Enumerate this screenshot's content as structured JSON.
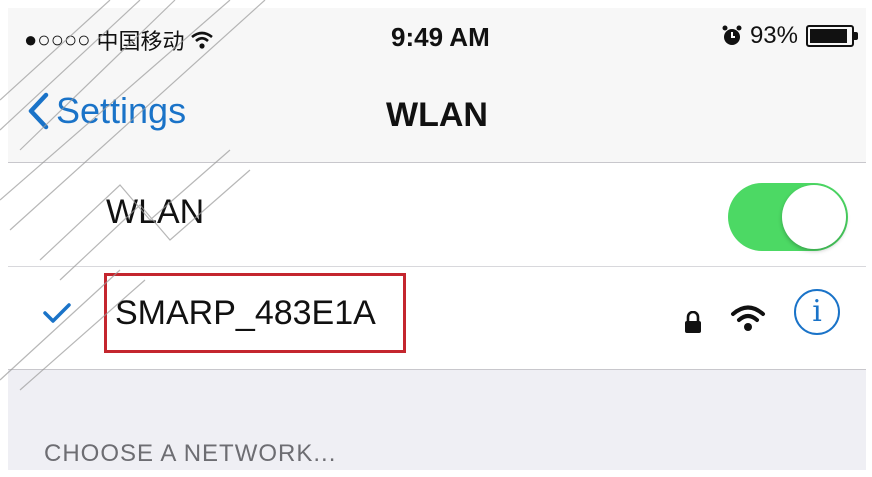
{
  "status_bar": {
    "signal": "●○○○○",
    "carrier": "中国移动",
    "time": "9:49 AM",
    "battery_percent": "93%",
    "battery_level": 0.93,
    "icons": [
      "wifi-icon",
      "alarm-icon",
      "battery-icon"
    ]
  },
  "nav": {
    "back_label": "Settings",
    "title": "WLAN"
  },
  "wlan_row": {
    "label": "WLAN",
    "toggle_on": true
  },
  "connected_network": {
    "name": "SMARP_483E1A",
    "connected": true,
    "secured": true,
    "info_symbol": "i"
  },
  "section_header": "CHOOSE A NETWORK...",
  "colors": {
    "accent": "#1a73c8",
    "toggle_on": "#4cd964",
    "highlight_box": "#c4262e"
  }
}
